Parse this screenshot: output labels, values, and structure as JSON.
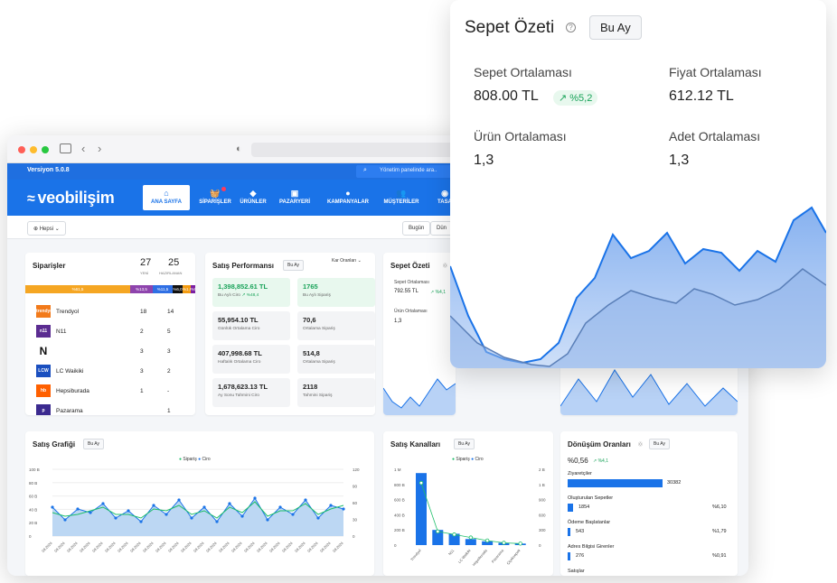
{
  "browser": {
    "version": "Versiyon 5.0.8",
    "search_placeholder": "Yönetim panelinde ara.."
  },
  "nav": {
    "brand": "veobilişim",
    "items": [
      {
        "label": "ANA SAYFA",
        "icon": "home-icon"
      },
      {
        "label": "SİPARİŞLER",
        "icon": "basket-icon"
      },
      {
        "label": "ÜRÜNLER",
        "icon": "tag-icon"
      },
      {
        "label": "PAZARYERİ",
        "icon": "store-icon"
      },
      {
        "label": "KAMPANYALAR",
        "icon": "percent-icon"
      },
      {
        "label": "MÜŞTERİLER",
        "icon": "users-icon"
      },
      {
        "label": "TASA",
        "icon": "palette-icon"
      }
    ]
  },
  "filters": {
    "scope": "Hepsi",
    "today": "Bugün",
    "yesterday": "Dün"
  },
  "orders": {
    "title": "Siparişler",
    "new_count": "27",
    "new_label": "YENİ",
    "prep_count": "25",
    "prep_label": "HAZIRLANAN",
    "segments": [
      {
        "label": "%61,5",
        "color": "#f5a623",
        "share": 0.615
      },
      {
        "label": "%13,5",
        "color": "#8e44ad",
        "share": 0.135
      },
      {
        "label": "%11,5",
        "color": "#2f6fe4",
        "share": 0.115
      },
      {
        "label": "%6,0",
        "color": "#111111",
        "share": 0.06
      },
      {
        "label": "%1,6",
        "color": "#f39c12",
        "share": 0.05
      },
      {
        "label": "%5,6",
        "color": "#7b1fa2",
        "share": 0.045
      }
    ],
    "stores": [
      {
        "name": "Trendyol",
        "v1": "18",
        "v2": "14",
        "logo_color": "#f27a1a",
        "logo_text": "trendyol"
      },
      {
        "name": "N11",
        "v1": "2",
        "v2": "5",
        "logo_color": "#5b2c91",
        "logo_text": "n11"
      },
      {
        "name": "",
        "v1": "3",
        "v2": "3",
        "logo_color": "#ffffff",
        "logo_text": "N"
      },
      {
        "name": "LC Waikiki",
        "v1": "3",
        "v2": "2",
        "logo_color": "#1a4fbf",
        "logo_text": "LCW"
      },
      {
        "name": "Hepsiburada",
        "v1": "1",
        "v2": "-",
        "logo_color": "#ff6000",
        "logo_text": "hb"
      },
      {
        "name": "Pazarama",
        "v1": "",
        "v2": "1",
        "logo_color": "#3b2a8f",
        "logo_text": "p"
      }
    ]
  },
  "performance": {
    "title": "Satış Performansı",
    "period": "Bu Ay",
    "dropdown": "Kar Oranları",
    "tiles": [
      {
        "value": "1,398,852.61 TL",
        "label": "Bu Aylı Ciro",
        "extra": "%48,4"
      },
      {
        "value": "1765",
        "label": "Bu Aylı Sipariş"
      },
      {
        "value": "55,954.10 TL",
        "label": "Günlük Ortalama Ciro"
      },
      {
        "value": "70,6",
        "label": "Ortalama Sipariş"
      },
      {
        "value": "407,998.68 TL",
        "label": "Haftalık Ortalama Ciro"
      },
      {
        "value": "514,8",
        "label": "Ortalama Sipariş"
      },
      {
        "value": "1,678,623.13 TL",
        "label": "Ay Sonu Tahmini Ciro"
      },
      {
        "value": "2118",
        "label": "Tahmini Sipariş"
      }
    ]
  },
  "basket_small": {
    "title": "Sepet Özeti",
    "avg_label": "Sepet Ortalaması",
    "avg_value": "792.55 TL",
    "avg_change": "%4,1",
    "prod_label": "Ürün Ortalaması",
    "prod_value": "1,3"
  },
  "sales_chart": {
    "title": "Satış Grafiği",
    "period": "Bu Ay",
    "legend": [
      "Sipariş",
      "Ciro"
    ],
    "y_left": [
      "100 B",
      "80 B",
      "60 B",
      "40 B",
      "20 B",
      "0"
    ],
    "y_right": [
      "120",
      "90",
      "60",
      "30",
      "0"
    ],
    "x_label": "09.2024"
  },
  "channels": {
    "title": "Satış Kanalları",
    "period": "Bu Ay",
    "legend": [
      "Sipariş",
      "Ciro"
    ],
    "y_left": [
      "1 M",
      "800 B",
      "600 B",
      "400 B",
      "200 B",
      "0"
    ],
    "y_right": [
      "2 B",
      "1 B",
      "900",
      "600",
      "300",
      "0"
    ],
    "categories": [
      "Trendyol",
      "",
      "N11",
      "LC Waikiki",
      "Hepsiburada",
      "Pazarama",
      "Çiçeksepeti"
    ]
  },
  "conversion": {
    "title": "Dönüşüm Oranları",
    "period": "Bu Ay",
    "rate": "%0,56",
    "rate_change": "%4,1",
    "rows": [
      {
        "label": "Ziyaretçiler",
        "value": "30382",
        "pct": "",
        "share": 1.0
      },
      {
        "label": "Oluşturulan Sepetler",
        "value": "1854",
        "pct": "%6,10",
        "share": 0.061
      },
      {
        "label": "Ödeme Başlatanlar",
        "value": "543",
        "pct": "%1,79",
        "share": 0.018
      },
      {
        "label": "Adres Bilgisi Girenler",
        "value": "276",
        "pct": "%0,91",
        "share": 0.009
      },
      {
        "label": "Satışlar",
        "value": "",
        "pct": "",
        "share": 0
      }
    ]
  },
  "popup": {
    "title": "Sepet Özeti",
    "period": "Bu Ay",
    "basket_avg_label": "Sepet Ortalaması",
    "basket_avg_value": "808.00 TL",
    "basket_avg_change": "%5,2",
    "price_avg_label": "Fiyat Ortalaması",
    "price_avg_value": "612.12 TL",
    "product_avg_label": "Ürün Ortalaması",
    "product_avg_value": "1,3",
    "qty_avg_label": "Adet Ortalaması",
    "qty_avg_value": "1,3"
  },
  "colors": {
    "brand": "#1a73e8",
    "green": "#1aa35a",
    "area": "#a9c8f4"
  }
}
